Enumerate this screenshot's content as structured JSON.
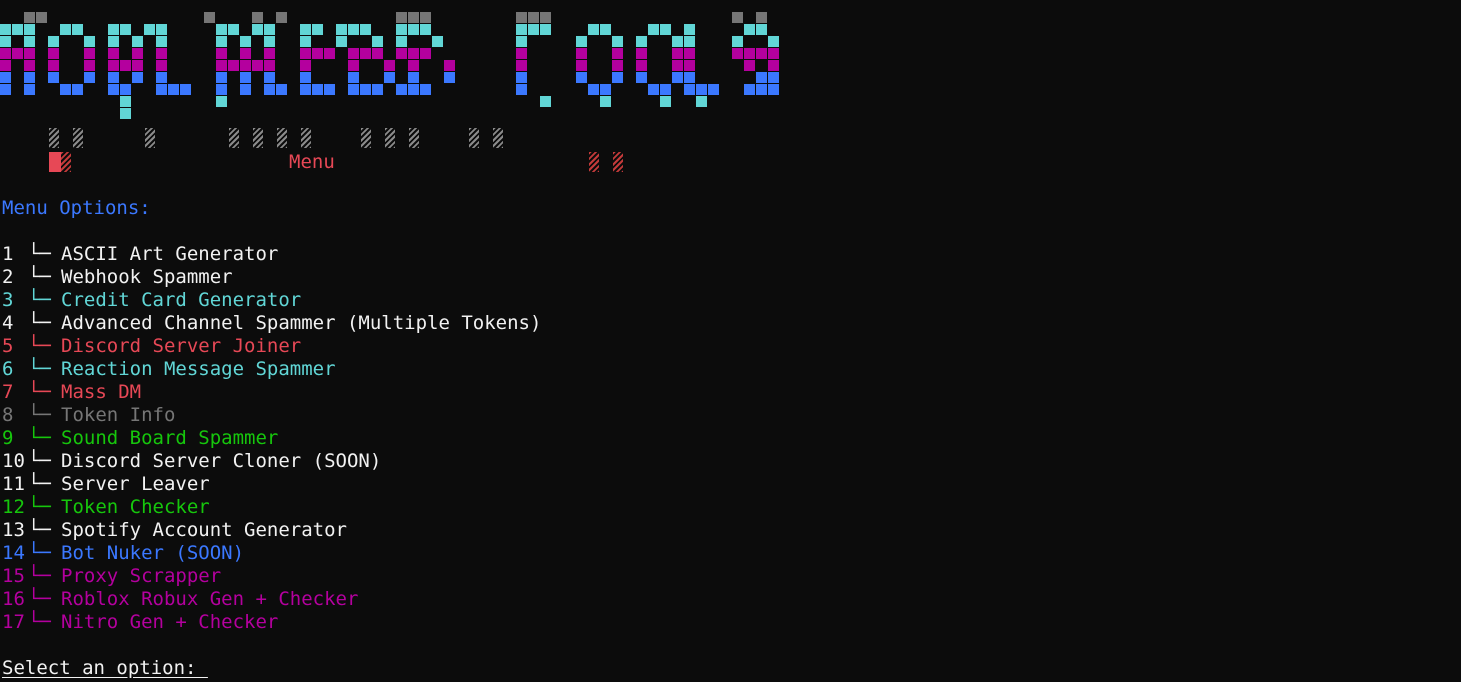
{
  "banner": {
    "title": "Rob Web Tools",
    "subtitle": "Menu"
  },
  "colors": {
    "background": "#0c0c0c",
    "white": "#f2f2f2",
    "cyan": "#61d6d6",
    "red": "#e74856",
    "gray": "#767676",
    "green": "#16c60c",
    "blue": "#3b78ff",
    "magenta": "#b4009e"
  },
  "menu": {
    "title": "Menu Options:",
    "branch_glyph": "└─",
    "items": [
      {
        "num": "1",
        "label": "ASCII Art Generator",
        "color": "white"
      },
      {
        "num": "2",
        "label": "Webhook Spammer",
        "color": "white"
      },
      {
        "num": "3",
        "label": "Credit Card Generator",
        "color": "cyan"
      },
      {
        "num": "4",
        "label": "Advanced Channel Spammer (Multiple Tokens)",
        "color": "white"
      },
      {
        "num": "5",
        "label": "Discord Server Joiner",
        "color": "red"
      },
      {
        "num": "6",
        "label": "Reaction Message Spammer",
        "color": "cyan"
      },
      {
        "num": "7",
        "label": "Mass DM",
        "color": "red"
      },
      {
        "num": "8",
        "label": "Token Info",
        "color": "gray"
      },
      {
        "num": "9",
        "label": "Sound Board Spammer",
        "color": "green"
      },
      {
        "num": "10",
        "label": "Discord Server Cloner (SOON)",
        "color": "white"
      },
      {
        "num": "11",
        "label": "Server Leaver",
        "color": "white"
      },
      {
        "num": "12",
        "label": "Token Checker",
        "color": "green"
      },
      {
        "num": "13",
        "label": "Spotify Account Generator",
        "color": "white"
      },
      {
        "num": "14",
        "label": "Bot Nuker (SOON)",
        "color": "blue"
      },
      {
        "num": "15",
        "label": "Proxy Scrapper",
        "color": "magenta"
      },
      {
        "num": "16",
        "label": "Roblox Robux Gen + Checker",
        "color": "magenta"
      },
      {
        "num": "17",
        "label": "Nitro Gen + Checker",
        "color": "magenta"
      }
    ]
  },
  "prompt": {
    "label": "Select an option: "
  }
}
